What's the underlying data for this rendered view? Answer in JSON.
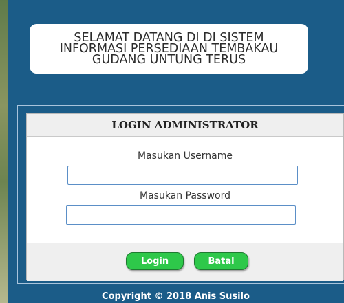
{
  "welcome": {
    "text": "SELAMAT DATANG DI DI SISTEM\nINFORMASI PERSEDIAAN TEMBAKAU\nGUDANG UNTUNG TERUS"
  },
  "login": {
    "title": "LOGIN ADMINISTRATOR",
    "username_label": "Masukan Username",
    "username_value": "",
    "password_label": "Masukan Password",
    "password_value": "",
    "login_button": "Login",
    "cancel_button": "Batal"
  },
  "footer": {
    "copyright": "Copyright © 2018 Anis Susilo"
  },
  "colors": {
    "background": "#1b5c88",
    "button": "#2ec84a"
  }
}
